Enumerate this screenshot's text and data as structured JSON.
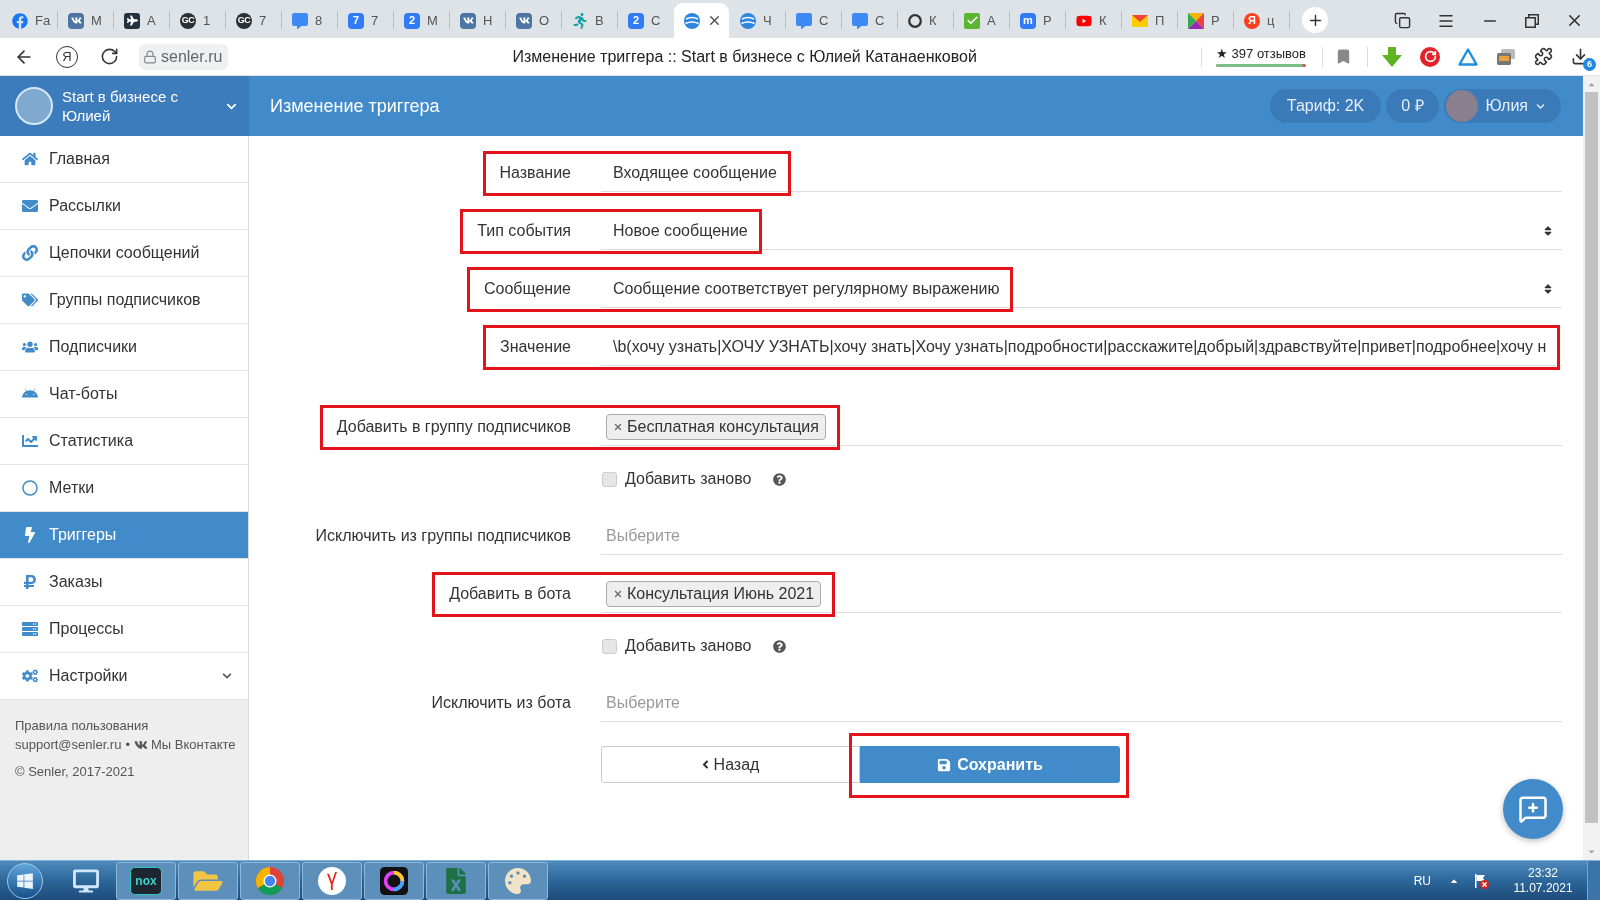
{
  "browser": {
    "tabs": [
      {
        "label": "Fa",
        "selected": false
      },
      {
        "label": "М",
        "selected": false
      },
      {
        "label": "А",
        "selected": false
      },
      {
        "label": "1",
        "selected": false,
        "icon_text": "GC"
      },
      {
        "label": "7",
        "selected": false,
        "icon_text": "GC"
      },
      {
        "label": "8",
        "selected": false
      },
      {
        "label": "7",
        "selected": false,
        "icon_text": "7"
      },
      {
        "label": "М",
        "selected": false,
        "icon_text": "2"
      },
      {
        "label": "Н",
        "selected": false
      },
      {
        "label": "О",
        "selected": false
      },
      {
        "label": "В",
        "selected": false
      },
      {
        "label": "С",
        "selected": false,
        "icon_text": "2"
      },
      {
        "selected": true
      },
      {
        "label": "Ч",
        "selected": false
      },
      {
        "label": "С",
        "selected": false
      },
      {
        "label": "С",
        "selected": false
      },
      {
        "label": "К",
        "selected": false
      },
      {
        "label": "А",
        "selected": false
      },
      {
        "label": "Р",
        "selected": false,
        "icon_text": "m"
      },
      {
        "label": "К",
        "selected": false
      },
      {
        "label": "П",
        "selected": false
      },
      {
        "label": "Р",
        "selected": false
      },
      {
        "label": "ц",
        "selected": false,
        "icon_text": "Я"
      }
    ],
    "logo_button": "Я",
    "address": "senler.ru",
    "page_title": "Изменение триггера :: Start в бизнесе с Юлией Катанаенковой",
    "reviews": {
      "text": "★ 397 отзывов",
      "level": 0.97
    },
    "downloads_count": "6"
  },
  "sidebar": {
    "project_name": "Start в бизнесе с Юлией",
    "items": [
      {
        "label": "Главная",
        "selected": false,
        "kind": "link"
      },
      {
        "label": "Рассылки",
        "selected": false,
        "kind": "link"
      },
      {
        "label": "Цепочки сообщений",
        "selected": false,
        "kind": "link"
      },
      {
        "label": "Группы подписчиков",
        "selected": false,
        "kind": "link"
      },
      {
        "label": "Подписчики",
        "selected": false,
        "kind": "link"
      },
      {
        "label": "Чат-боты",
        "selected": false,
        "kind": "link"
      },
      {
        "label": "Статистика",
        "selected": false,
        "kind": "link"
      },
      {
        "label": "Метки",
        "selected": false,
        "kind": "link"
      },
      {
        "label": "Триггеры",
        "selected": true,
        "kind": "link"
      },
      {
        "label": "Заказы",
        "selected": false,
        "kind": "link"
      },
      {
        "label": "Процессы",
        "selected": false,
        "kind": "link"
      },
      {
        "label": "Настройки",
        "selected": false,
        "kind": "submenu"
      }
    ],
    "footer": {
      "terms_link": "Правила пользования",
      "support_email": "support@senler.ru",
      "separator": "•",
      "vk_link": "Мы Вконтакте",
      "copyright": "© Senler, 2017-2021"
    }
  },
  "header": {
    "page_title": "Изменение триггера",
    "tariff": "Тариф: 2K",
    "balance": "0 ₽",
    "user_name": "Юлия"
  },
  "form": {
    "event_fields": [
      {
        "label": "Название",
        "kind": "text",
        "value": "Входящее сообщение",
        "highlighted": true
      },
      {
        "label": "Тип события",
        "kind": "select",
        "value": "Новое сообщение",
        "highlighted": true
      },
      {
        "label": "Сообщение",
        "kind": "select",
        "value": "Сообщение соответствует регулярному выражению",
        "highlighted": true
      },
      {
        "label": "Значение",
        "kind": "text",
        "value": "\\b(хочу узнать|ХОЧУ УЗНАТЬ|хочу знать|Хочу узнать|подробности|расскажите|добрый|здравствуйте|привет|подробнее|хочу н",
        "highlighted": true
      }
    ],
    "action_fields": [
      {
        "label": "Добавить в группу подписчиков",
        "kind": "tags",
        "tags": [
          "Бесплатная консультация"
        ],
        "highlighted": true
      },
      {
        "label": "Добавить заново",
        "kind": "checkbox",
        "checked": false
      },
      {
        "label": "Исключить из группы подписчиков",
        "kind": "tags",
        "placeholder": "Выберите",
        "highlighted": false
      },
      {
        "label": "Добавить в бота",
        "kind": "tags",
        "tags": [
          "Консультация Июнь 2021"
        ],
        "highlighted": true
      },
      {
        "label": "Добавить заново",
        "kind": "checkbox",
        "checked": false
      },
      {
        "label": "Исключить из бота",
        "kind": "tags",
        "placeholder": "Выберите",
        "highlighted": false
      }
    ],
    "buttons": [
      {
        "label": "Назад",
        "kind": "back",
        "highlighted": false
      },
      {
        "label": "Сохранить",
        "kind": "save",
        "highlighted": true
      }
    ]
  },
  "taskbar": {
    "app_logo_text": "nox",
    "language": "RU",
    "time": "23:32",
    "date": "11.07.2021"
  }
}
